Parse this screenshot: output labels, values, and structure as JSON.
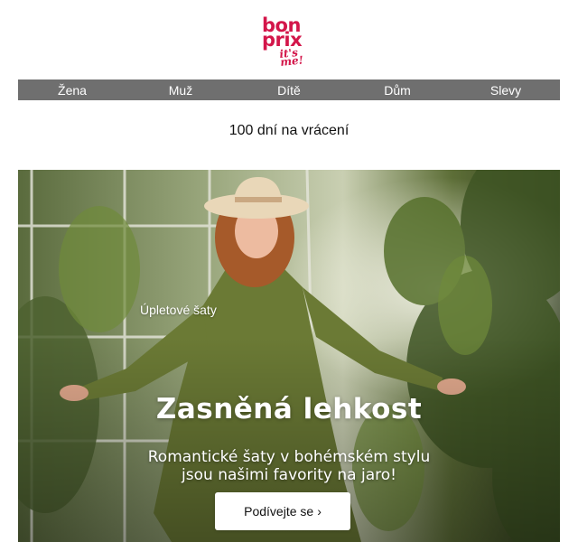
{
  "brand": {
    "logo_word_1": "bon",
    "logo_word_2": "prix",
    "logo_tagline": "it's me!",
    "color": "#d3164a"
  },
  "nav": {
    "items": [
      {
        "label": "Žena"
      },
      {
        "label": "Muž"
      },
      {
        "label": "Dítě"
      },
      {
        "label": "Dům"
      },
      {
        "label": "Slevy"
      }
    ],
    "background": "#6f6f6f"
  },
  "banner": {
    "text": "100 dní na vrácení"
  },
  "hero": {
    "eyebrow": "Úpletové šaty",
    "title": "Zasněná lehkost",
    "subtitle_line_1": "Romantické šaty v bohémském stylu",
    "subtitle_line_2": "jsou našimi favority na jaro!",
    "cta_label": "Podívejte se",
    "cta_icon": "chevron-right-icon"
  }
}
